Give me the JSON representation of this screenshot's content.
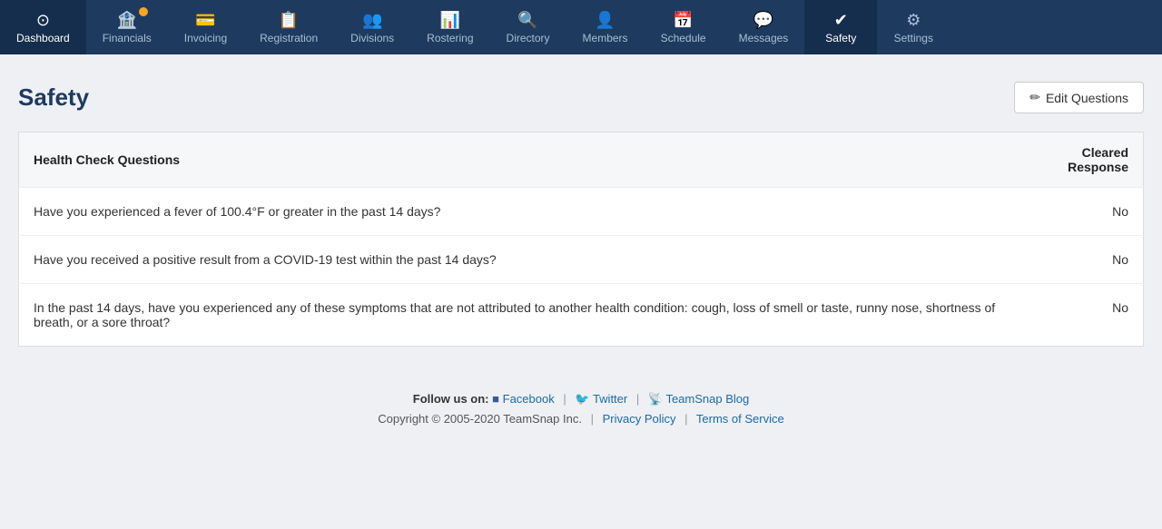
{
  "nav": {
    "items": [
      {
        "label": "Dashboard",
        "icon": "⊙",
        "active": false,
        "name": "dashboard"
      },
      {
        "label": "Financials",
        "icon": "🏦",
        "active": false,
        "name": "financials",
        "badge": true
      },
      {
        "label": "Invoicing",
        "icon": "💳",
        "active": false,
        "name": "invoicing"
      },
      {
        "label": "Registration",
        "icon": "📋",
        "active": false,
        "name": "registration"
      },
      {
        "label": "Divisions",
        "icon": "👥",
        "active": false,
        "name": "divisions"
      },
      {
        "label": "Rostering",
        "icon": "📊",
        "active": false,
        "name": "rostering"
      },
      {
        "label": "Directory",
        "icon": "🔍",
        "active": false,
        "name": "directory"
      },
      {
        "label": "Members",
        "icon": "👤",
        "active": false,
        "name": "members"
      },
      {
        "label": "Schedule",
        "icon": "📅",
        "active": false,
        "name": "schedule"
      },
      {
        "label": "Messages",
        "icon": "💬",
        "active": false,
        "name": "messages"
      },
      {
        "label": "Safety",
        "icon": "✔",
        "active": true,
        "name": "safety"
      },
      {
        "label": "Settings",
        "icon": "⚙",
        "active": false,
        "name": "settings"
      }
    ]
  },
  "page": {
    "title": "Safety",
    "edit_button_label": "Edit Questions",
    "edit_button_icon": "✏"
  },
  "table": {
    "col_question": "Health Check Questions",
    "col_response": "Cleared Response",
    "rows": [
      {
        "question": "Have you experienced a fever of 100.4°F or greater in the past 14 days?",
        "response": "No"
      },
      {
        "question": "Have you received a positive result from a COVID-19 test within the past 14 days?",
        "response": "No"
      },
      {
        "question": "In the past 14 days, have you experienced any of these symptoms that are not attributed to another health condition: cough, loss of smell or taste, runny nose, shortness of breath, or a sore throat?",
        "response": "No"
      }
    ]
  },
  "footer": {
    "follow_label": "Follow us on:",
    "facebook_label": "Facebook",
    "twitter_label": "Twitter",
    "blog_label": "TeamSnap Blog",
    "copyright": "Copyright © 2005-2020 TeamSnap Inc.",
    "privacy_label": "Privacy Policy",
    "terms_label": "Terms of Service"
  }
}
